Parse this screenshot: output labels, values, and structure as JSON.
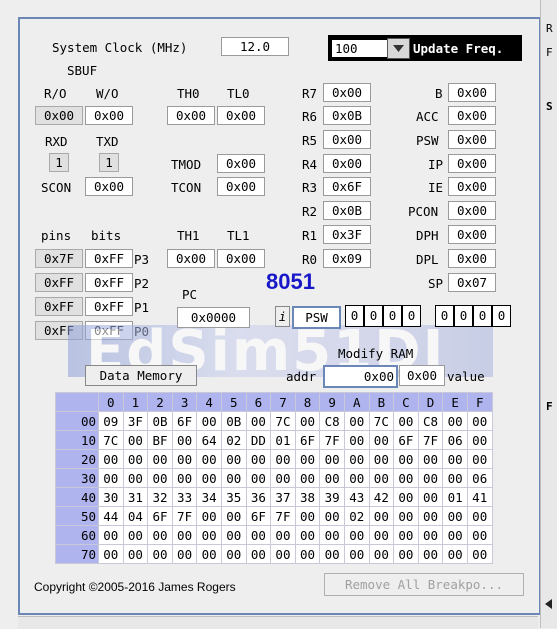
{
  "clock": {
    "label": "System Clock (MHz)",
    "value": "12.0"
  },
  "update": {
    "value": "100",
    "button": "Update Freq."
  },
  "sbuf": {
    "title": "SBUF",
    "ro_label": "R/O",
    "wo_label": "W/O",
    "ro_value": "0x00",
    "wo_value": "0x00"
  },
  "serial": {
    "rxd_label": "RXD",
    "txd_label": "TXD",
    "rxd_value": "1",
    "txd_value": "1",
    "scon_label": "SCON",
    "scon_value": "0x00"
  },
  "timers": {
    "th0_label": "TH0",
    "tl0_label": "TL0",
    "th0": "0x00",
    "tl0": "0x00",
    "tmod_label": "TMOD",
    "tmod": "0x00",
    "tcon_label": "TCON",
    "tcon": "0x00",
    "th1_label": "TH1",
    "tl1_label": "TL1",
    "th1": "0x00",
    "tl1": "0x00"
  },
  "regs": [
    {
      "name": "R7",
      "value": "0x00"
    },
    {
      "name": "R6",
      "value": "0x0B"
    },
    {
      "name": "R5",
      "value": "0x00"
    },
    {
      "name": "R4",
      "value": "0x00"
    },
    {
      "name": "R3",
      "value": "0x6F"
    },
    {
      "name": "R2",
      "value": "0x0B"
    },
    {
      "name": "R1",
      "value": "0x3F"
    },
    {
      "name": "R0",
      "value": "0x09"
    }
  ],
  "sfr": [
    {
      "name": "B",
      "value": "0x00"
    },
    {
      "name": "ACC",
      "value": "0x00"
    },
    {
      "name": "PSW",
      "value": "0x00"
    },
    {
      "name": "IP",
      "value": "0x00"
    },
    {
      "name": "IE",
      "value": "0x00"
    },
    {
      "name": "PCON",
      "value": "0x00"
    },
    {
      "name": "DPH",
      "value": "0x00"
    },
    {
      "name": "DPL",
      "value": "0x00"
    },
    {
      "name": "SP",
      "value": "0x07"
    }
  ],
  "ports": {
    "pins_label": "pins",
    "bits_label": "bits",
    "rows": [
      {
        "name": "P3",
        "pins": "0x7F",
        "bits": "0xFF"
      },
      {
        "name": "P2",
        "pins": "0xFF",
        "bits": "0xFF"
      },
      {
        "name": "P1",
        "pins": "0xFF",
        "bits": "0xFF"
      },
      {
        "name": "P0",
        "pins": "0xFF",
        "bits": "0xFF"
      }
    ]
  },
  "chip": "8051",
  "pc": {
    "label": "PC",
    "value": "0x0000",
    "info_button": "i",
    "psw_label": "PSW",
    "psw_bits_high": [
      "0",
      "0",
      "0",
      "0"
    ],
    "psw_bits_low": [
      "0",
      "0",
      "0",
      "0"
    ]
  },
  "modify": {
    "title": "Modify RAM",
    "addr_label": "addr",
    "addr_value": "0x00",
    "value_value": "0x00",
    "value_label": "value"
  },
  "memory_button": "Data Memory",
  "watermark": "EdSim51DI",
  "memory": {
    "cols": [
      "0",
      "1",
      "2",
      "3",
      "4",
      "5",
      "6",
      "7",
      "8",
      "9",
      "A",
      "B",
      "C",
      "D",
      "E",
      "F"
    ],
    "rows": [
      {
        "addr": "00",
        "cells": [
          "09",
          "3F",
          "0B",
          "6F",
          "00",
          "0B",
          "00",
          "7C",
          "00",
          "C8",
          "00",
          "7C",
          "00",
          "C8",
          "00",
          "00"
        ]
      },
      {
        "addr": "10",
        "cells": [
          "7C",
          "00",
          "BF",
          "00",
          "64",
          "02",
          "DD",
          "01",
          "6F",
          "7F",
          "00",
          "00",
          "6F",
          "7F",
          "06",
          "00"
        ]
      },
      {
        "addr": "20",
        "cells": [
          "00",
          "00",
          "00",
          "00",
          "00",
          "00",
          "00",
          "00",
          "00",
          "00",
          "00",
          "00",
          "00",
          "00",
          "00",
          "00"
        ]
      },
      {
        "addr": "30",
        "cells": [
          "00",
          "00",
          "00",
          "00",
          "00",
          "00",
          "00",
          "00",
          "00",
          "00",
          "00",
          "00",
          "00",
          "00",
          "00",
          "06"
        ]
      },
      {
        "addr": "40",
        "cells": [
          "30",
          "31",
          "32",
          "33",
          "34",
          "35",
          "36",
          "37",
          "38",
          "39",
          "43",
          "42",
          "00",
          "00",
          "01",
          "41"
        ]
      },
      {
        "addr": "50",
        "cells": [
          "44",
          "04",
          "6F",
          "7F",
          "00",
          "00",
          "6F",
          "7F",
          "00",
          "00",
          "02",
          "00",
          "00",
          "00",
          "00",
          "00"
        ]
      },
      {
        "addr": "60",
        "cells": [
          "00",
          "00",
          "00",
          "00",
          "00",
          "00",
          "00",
          "00",
          "00",
          "00",
          "00",
          "00",
          "00",
          "00",
          "00",
          "00"
        ]
      },
      {
        "addr": "70",
        "cells": [
          "00",
          "00",
          "00",
          "00",
          "00",
          "00",
          "00",
          "00",
          "00",
          "00",
          "00",
          "00",
          "00",
          "00",
          "00",
          "00"
        ]
      }
    ]
  },
  "copyright": "Copyright ©2005-2016 James Rogers",
  "remove_button": "Remove All Breakpo...",
  "side_labels": [
    "R",
    "F",
    "S",
    "F"
  ]
}
